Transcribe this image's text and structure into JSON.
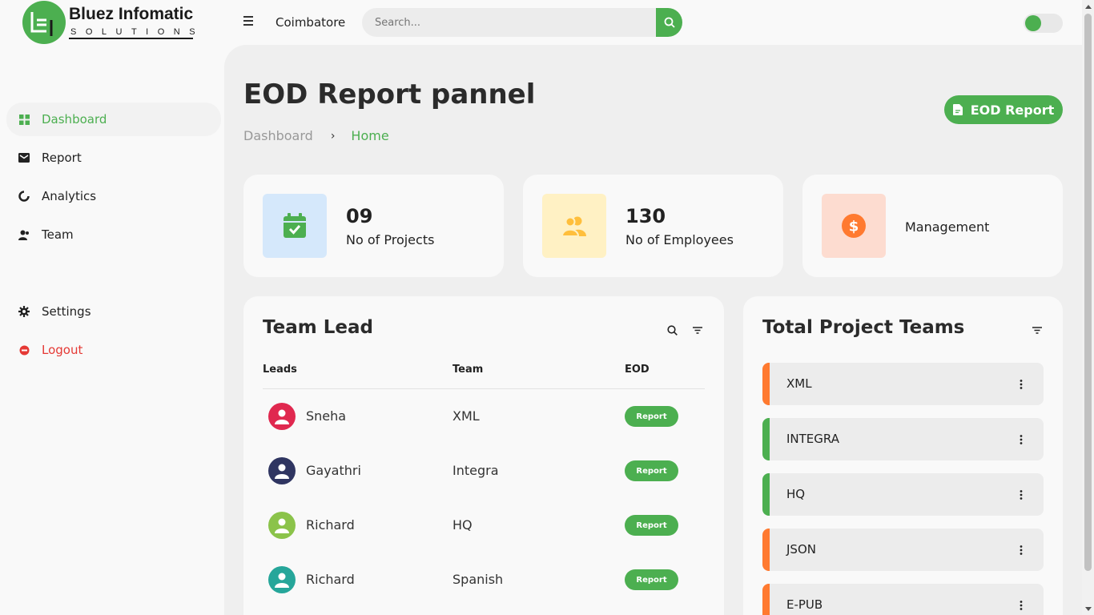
{
  "brand": {
    "name": "Bluez Infomatic",
    "tagline": "SOLUTIONS"
  },
  "header": {
    "location": "Coimbatore",
    "search_placeholder": "Search..."
  },
  "sidebar": {
    "items": [
      {
        "label": "Dashboard",
        "icon": "dashboard-icon",
        "active": true
      },
      {
        "label": "Report",
        "icon": "mail-icon"
      },
      {
        "label": "Analytics",
        "icon": "analytics-icon"
      },
      {
        "label": "Team",
        "icon": "team-icon"
      },
      {
        "label": "Settings",
        "icon": "gear-icon"
      },
      {
        "label": "Logout",
        "icon": "logout-icon"
      }
    ]
  },
  "page": {
    "title": "EOD Report pannel",
    "breadcrumb": [
      "Dashboard",
      "Home"
    ],
    "eod_button": "EOD Report"
  },
  "stats": [
    {
      "value": "09",
      "label": "No of Projects",
      "icon": "calendar-check-icon"
    },
    {
      "value": "130",
      "label": "No of Employees",
      "icon": "users-icon"
    },
    {
      "value": "",
      "label": "Management",
      "icon": "dollar-icon"
    }
  ],
  "team_lead": {
    "title": "Team Lead",
    "columns": [
      "Leads",
      "Team",
      "EOD"
    ],
    "rows": [
      {
        "lead": "Sneha",
        "team": "XML",
        "action": "Report",
        "avatar_color": "#e0284f"
      },
      {
        "lead": "Gayathri",
        "team": "Integra",
        "action": "Report",
        "avatar_color": "#2f3561"
      },
      {
        "lead": "Richard",
        "team": "HQ",
        "action": "Report",
        "avatar_color": "#8bc34a"
      },
      {
        "lead": "Richard",
        "team": "Spanish",
        "action": "Report",
        "avatar_color": "#26a69a"
      }
    ]
  },
  "project_teams": {
    "title": "Total Project Teams",
    "items": [
      {
        "name": "XML",
        "color": "#ff7a30"
      },
      {
        "name": "INTEGRA",
        "color": "#4caf50"
      },
      {
        "name": "HQ",
        "color": "#4caf50"
      },
      {
        "name": "JSON",
        "color": "#ff7a30"
      },
      {
        "name": "E-PUB",
        "color": "#ff7a30"
      }
    ]
  },
  "colors": {
    "accent": "#4caf50",
    "danger": "#e53935",
    "orange": "#ff7a30"
  }
}
